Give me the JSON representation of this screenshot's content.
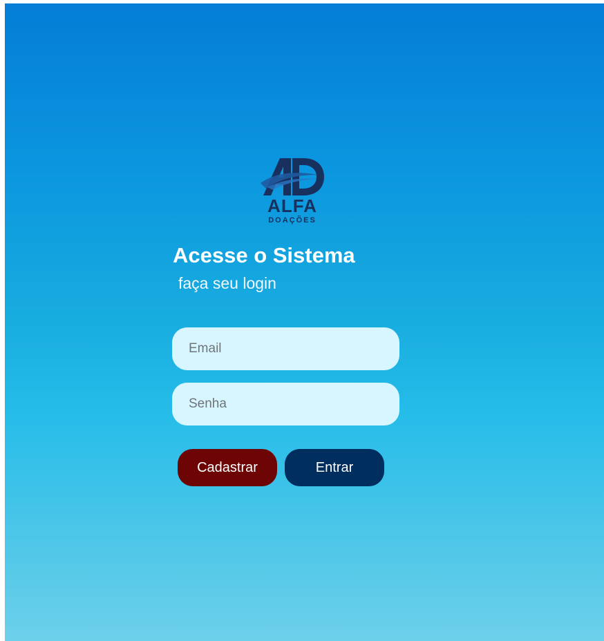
{
  "brand": {
    "name": "ALFA",
    "subname": "DOAÇÕES",
    "monogram": "AD"
  },
  "login": {
    "title": "Acesse o Sistema",
    "subtitle": "faça seu login",
    "email_placeholder": "Email",
    "password_placeholder": "Senha",
    "register_label": "Cadastrar",
    "enter_label": "Entrar"
  },
  "colors": {
    "background_top": "#047dd6",
    "background_bottom": "#6dd0ea",
    "input_background": "#d8f6ff",
    "register_button": "#6e0505",
    "enter_button": "#002f5f",
    "logo": "#17305e"
  }
}
